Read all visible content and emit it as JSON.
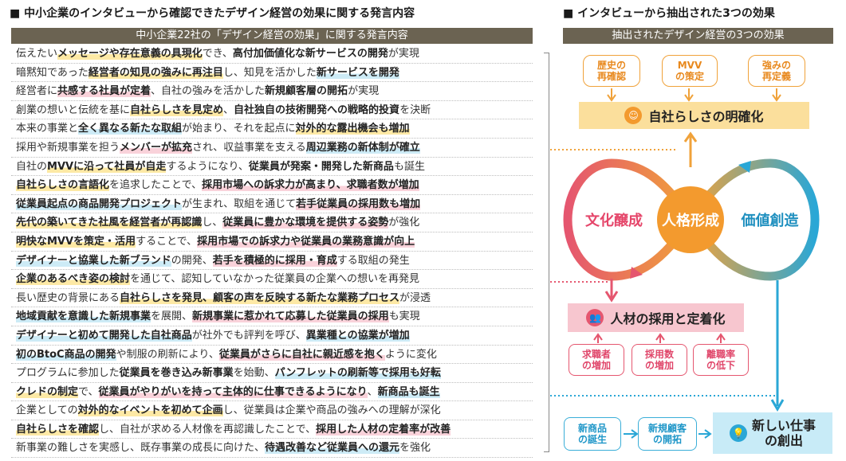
{
  "left": {
    "section_title": "■ 中小企業のインタビューから確認できたデザイン経営の効果に関する発言内容",
    "table_header": "中小企業22社の「デザイン経営の効果」に関する発言内容",
    "rows": [
      "伝えたい<b class=\"y\">メッセージや存在意義の具現化</b>でき、<b>高付加価値化な新サービスの開発</b>が実現",
      "暗黙知であった<b class=\"y\">経営者の知見の強みに再注目</b>し、知見を活かした<b class=\"b\">新サービスを開発</b>",
      "経営者に<b class=\"p\">共感する社員が定着</b>、自社の強みを活かした<b>新規顧客層の開拓</b>が実現",
      "創業の想いと伝統を基に<b class=\"y\">自社らしさを見定め</b>、<b>自社独自の技術開発への戦略的投資</b>を決断",
      "本来の事業と<b class=\"b\">全く異なる新たな取組</b>が始まり、それを起点に<b class=\"y\">対外的な露出機会も増加</b>",
      "採用や新規事業を担う<b class=\"p\">メンバーが拡充</b>され、収益事業を支える<b class=\"b\">周辺業務の新体制が確立</b>",
      "自社の<b class=\"y\">MVVに沿って社員が自走</b>するようになり、<b>従業員が発案・開発した新商品</b>も誕生",
      "<b class=\"y\">自社らしさの言語化</b>を追求したことで、<b class=\"p\">採用市場への訴求力が高まり、求職者数が増加</b>",
      "<b class=\"b\">従業員起点の商品開発プロジェクト</b>が生まれ、取組を通じて<b class=\"p\">若手従業員の採用数も増加</b>",
      "<b class=\"y\">先代の築いてきた社風を経営者が再認識</b>し、<b class=\"p\">従業員に豊かな環境を提供する姿勢</b>が強化",
      "<b class=\"y\">明快なMVVを策定・活用</b>することで、<b class=\"p\">採用市場での訴求力や従業員の業務意識が向上</b>",
      "<b class=\"b\">デザイナーと協業した新ブランド</b>の開発、<b class=\"p\">若手を積極的に採用・育成</b>する取組の発生",
      "<b class=\"y\">企業のあるべき姿の検討</b>を通じて、認知していなかった従業員の企業への想いを再発見",
      "長い歴史の背景にある<b class=\"y\">自社らしさを発見、顧客の声を反映する新たな業務プロセス</b>が浸透",
      "<b class=\"b\">地域貢献を意識した新規事業</b>を展開、<b class=\"p\">新規事業に惹かれて応募した従業員の採用</b>も実現",
      "<b class=\"b\">デザイナーと初めて開発した自社商品</b>が社外でも評判を呼び、<b class=\"b\">異業種との協業が増加</b>",
      "<b class=\"b\">初のBtoC商品の開発</b>や制服の刷新により、<b class=\"p\">従業員がさらに自社に親近感を抱く</b>ように変化",
      "プログラムに参加した<b>従業員を巻き込み新事業</b>を始動、<b class=\"b\">パンフレットの刷新等で採用も好転</b>",
      "<b class=\"y\">クレドの制定</b>で、<b class=\"p\">従業員がやりがいを持って主体的に仕事できるようになり</b>、<b class=\"b\">新商品も誕生</b>",
      "企業としての<b class=\"y\">対外的なイベントを初めて企画</b>し、従業員は企業や商品の強みへの理解が深化",
      "<b class=\"y\">自社らしさを確認</b>し、自社が求める人材像を再認識したことで、<b class=\"p\">採用した人材の定着率が改善</b>",
      "新事業の難しさを実感し、既存事業の成長に向けた、<b class=\"b\">待遇改善など従業員への還元</b>を強化"
    ]
  },
  "right": {
    "section_title": "■ インタビューから抽出された3つの効果",
    "header": "抽出されたデザイン経営の3つの効果",
    "top_small": [
      "歴史の\n再確認",
      "MVV\nの策定",
      "強みの\n再定義"
    ],
    "top_main": "自社らしさの明確化",
    "loop_left": "文化醸成",
    "loop_center": "人格形成",
    "loop_right": "価値創造",
    "mid_main": "人材の採用と定着化",
    "mid_small": [
      "求職者\nの増加",
      "採用数\nの増加",
      "離職率\nの低下"
    ],
    "bottom_small": [
      "新商品\nの誕生",
      "新規顧客\nの開拓"
    ],
    "bottom_main": "新しい仕事\nの創出",
    "colors": {
      "orange": "#f0a23a",
      "pink": "#e5566f",
      "blue": "#2aa7d6",
      "header": "#6b6352"
    }
  }
}
